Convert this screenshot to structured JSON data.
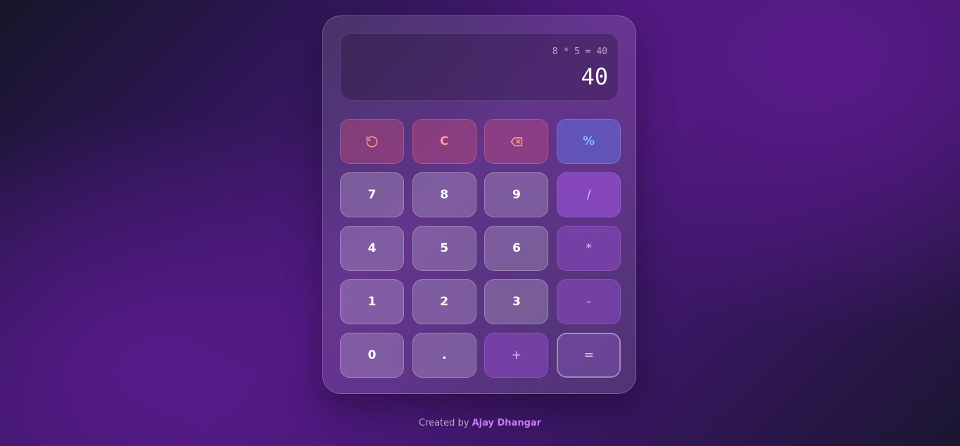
{
  "display": {
    "expression": "8 * 5 = 40",
    "result": "40"
  },
  "keys": [
    {
      "label": "",
      "icon": "undo-icon",
      "kind": "fn"
    },
    {
      "label": "C",
      "kind": "fn"
    },
    {
      "label": "",
      "icon": "backspace-icon",
      "kind": "fn"
    },
    {
      "label": "%",
      "kind": "pct"
    },
    {
      "label": "7",
      "kind": "num"
    },
    {
      "label": "8",
      "kind": "num"
    },
    {
      "label": "9",
      "kind": "num"
    },
    {
      "label": "/",
      "kind": "op"
    },
    {
      "label": "4",
      "kind": "num"
    },
    {
      "label": "5",
      "kind": "num"
    },
    {
      "label": "6",
      "kind": "num"
    },
    {
      "label": "*",
      "kind": "op"
    },
    {
      "label": "1",
      "kind": "num"
    },
    {
      "label": "2",
      "kind": "num"
    },
    {
      "label": "3",
      "kind": "num"
    },
    {
      "label": "-",
      "kind": "op"
    },
    {
      "label": "0",
      "kind": "num"
    },
    {
      "label": ".",
      "kind": "num"
    },
    {
      "label": "+",
      "kind": "op"
    },
    {
      "label": "=",
      "kind": "eq"
    }
  ],
  "footer": {
    "prefix": "Created by",
    "author": "Ajay Dhangar"
  },
  "colors": {
    "function_key": "#ff9a9a",
    "percent_key": "#7fc1ff",
    "author_accent": "#c57cf2"
  }
}
